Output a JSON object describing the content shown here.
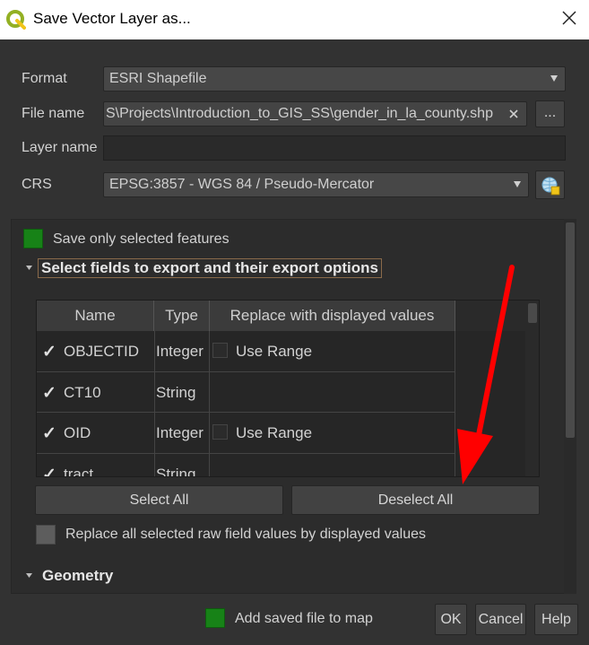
{
  "window": {
    "title": "Save Vector Layer as..."
  },
  "form": {
    "format_label": "Format",
    "format_value": "ESRI Shapefile",
    "filename_label": "File name",
    "filename_value": "S\\Projects\\Introduction_to_GIS_SS\\gender_in_la_county.shp",
    "browse_label": "...",
    "layername_label": "Layer name",
    "layername_value": "",
    "crs_label": "CRS",
    "crs_value": "EPSG:3857 - WGS 84 / Pseudo-Mercator"
  },
  "options": {
    "save_selected_label": "Save only selected features",
    "fields_section_label": "Select fields to export and their export options",
    "select_all_label": "Select All",
    "deselect_all_label": "Deselect All",
    "replace_raw_label": "Replace all selected raw field values by displayed values",
    "geometry_section_label": "Geometry"
  },
  "fields_table": {
    "headers": [
      "Name",
      "Type",
      "Replace with displayed values"
    ],
    "rows": [
      {
        "checked": "✓",
        "name": "OBJECTID",
        "type": "Integer",
        "replace": "Use Range"
      },
      {
        "checked": "✓",
        "name": "CT10",
        "type": "String",
        "replace": ""
      },
      {
        "checked": "✓",
        "name": "OID",
        "type": "Integer",
        "replace": "Use Range"
      },
      {
        "checked": "✓",
        "name": "tract",
        "type": "String",
        "replace": ""
      }
    ]
  },
  "footer": {
    "add_to_map_label": "Add saved file to map",
    "ok_label": "OK",
    "cancel_label": "Cancel",
    "help_label": "Help"
  },
  "colors": {
    "checkbox_green": "#178217",
    "annotation_arrow": "#ff0000"
  },
  "icons": [
    "qgis-logo-icon",
    "close-icon",
    "dropdown-arrow-icon",
    "clear-icon",
    "crs-globe-icon",
    "collapse-arrow-icon"
  ]
}
